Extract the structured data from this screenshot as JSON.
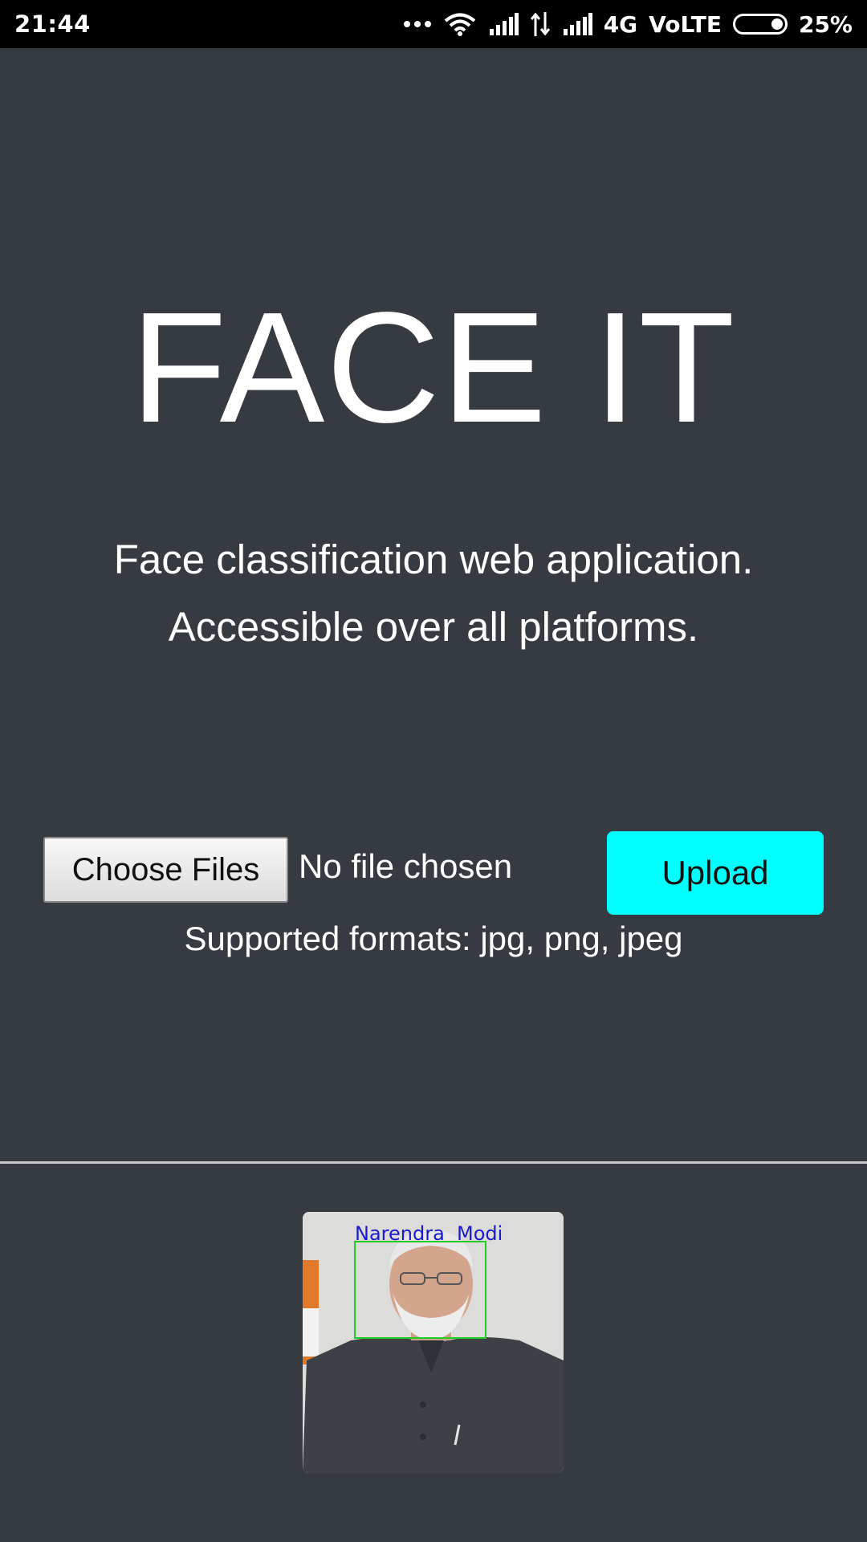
{
  "status_bar": {
    "time": "21:44",
    "network": "4G",
    "volte": "VoLTE",
    "battery_text": "25%",
    "battery_level": 0.25,
    "icons": [
      "more-dots-icon",
      "wifi-icon",
      "signal-icon",
      "data-arrows-icon",
      "signal-icon",
      "battery-icon"
    ]
  },
  "app": {
    "title": "FACE IT",
    "tagline_line1": "Face classification web application.",
    "tagline_line2": "Accessible over all platforms."
  },
  "upload_form": {
    "choose_label": "Choose Files",
    "file_status": "No file chosen",
    "upload_label": "Upload",
    "formats_text": "Supported formats: jpg, png, jpeg",
    "upload_color": "#00ffff"
  },
  "result": {
    "detected_name": "Narendra  Modi",
    "label_color": "#1a1acc",
    "box_color": "#22cc22"
  },
  "colors": {
    "background": "#363a41",
    "status_bar": "#000000",
    "text": "#ffffff"
  }
}
